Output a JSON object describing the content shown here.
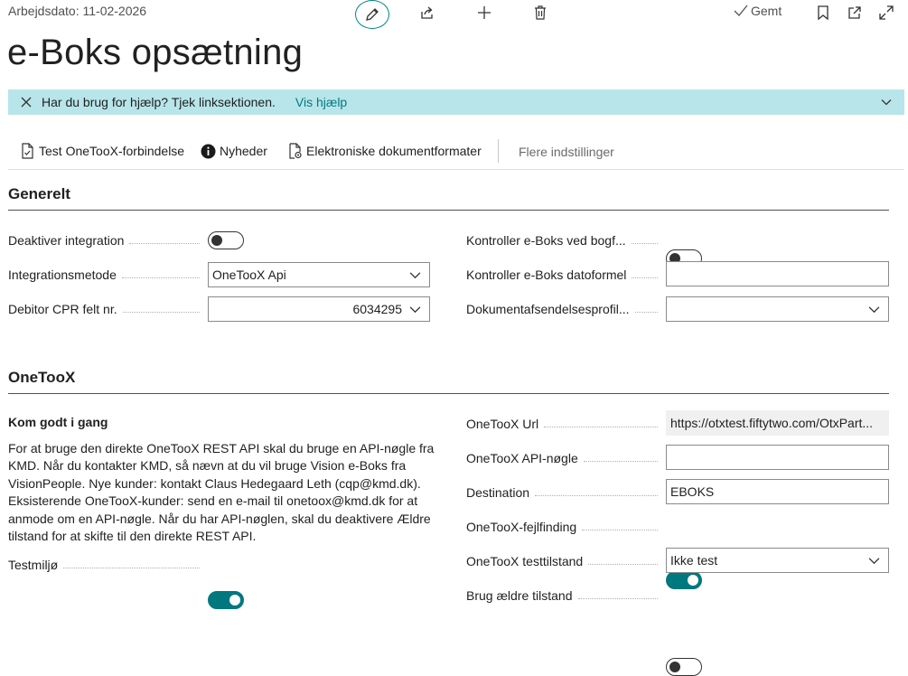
{
  "header": {
    "work_date": "Arbejdsdato: 11-02-2026",
    "saved_label": "Gemt",
    "icons": [
      "pencil-icon",
      "share-icon",
      "plus-icon",
      "trash-icon",
      "bookmark-icon",
      "open-new-window-icon",
      "expand-icon"
    ]
  },
  "page_title": "e-Boks opsætning",
  "help_banner": {
    "message": "Har du brug for hjælp? Tjek linksektionen.",
    "link": "Vis hjælp"
  },
  "actions": {
    "test_connection": "Test OneTooX-forbindelse",
    "news": "Nyheder",
    "doc_formats": "Elektroniske dokumentformater",
    "more_settings": "Flere indstillinger"
  },
  "general": {
    "title": "Generelt",
    "disable_integration": {
      "label": "Deaktiver integration",
      "on": false
    },
    "integration_method": {
      "label": "Integrationsmetode",
      "value": "OneTooX Api"
    },
    "debtor_cpr": {
      "label": "Debitor CPR felt nr.",
      "value": "6034295"
    },
    "check_posting": {
      "label": "Kontroller e-Boks ved bogf...",
      "on": false
    },
    "check_date_formula": {
      "label": "Kontroller e-Boks datoformel",
      "value": ""
    },
    "doc_sending_profile": {
      "label": "Dokumentafsendelsesprofil...",
      "value": ""
    }
  },
  "onetoox": {
    "title": "OneTooX",
    "intro_title": "Kom godt i gang",
    "intro_text": "For at bruge den direkte OneTooX REST API skal du bruge en API-nøgle fra KMD. Når du kontakter KMD, så nævn at du vil bruge Vision e-Boks fra VisionPeople. Nye kunder: kontakt Claus Hedegaard Leth (cqp@kmd.dk). Eksisterende OneTooX-kunder: send en e-mail til onetoox@kmd.dk for at anmode om en API-nøgle. Når du har API-nøglen, skal du deaktivere Ældre tilstand for at skifte til den direkte REST API.",
    "test_env": {
      "label": "Testmiljø",
      "on": true
    },
    "url": {
      "label": "OneTooX Url",
      "value": "https://otxtest.fiftytwo.com/OtxPart..."
    },
    "api_key": {
      "label": "OneTooX API-nøgle",
      "value": ""
    },
    "destination": {
      "label": "Destination",
      "value": "EBOKS"
    },
    "debug": {
      "label": "OneTooX-fejlfinding",
      "on": true
    },
    "test_mode": {
      "label": "OneTooX testtilstand",
      "value": "Ikke test"
    },
    "legacy_mode": {
      "label": "Brug ældre tilstand",
      "on": false
    }
  },
  "colors": {
    "accent": "#00787e",
    "banner": "#b8e5ea",
    "link": "#007a80"
  }
}
